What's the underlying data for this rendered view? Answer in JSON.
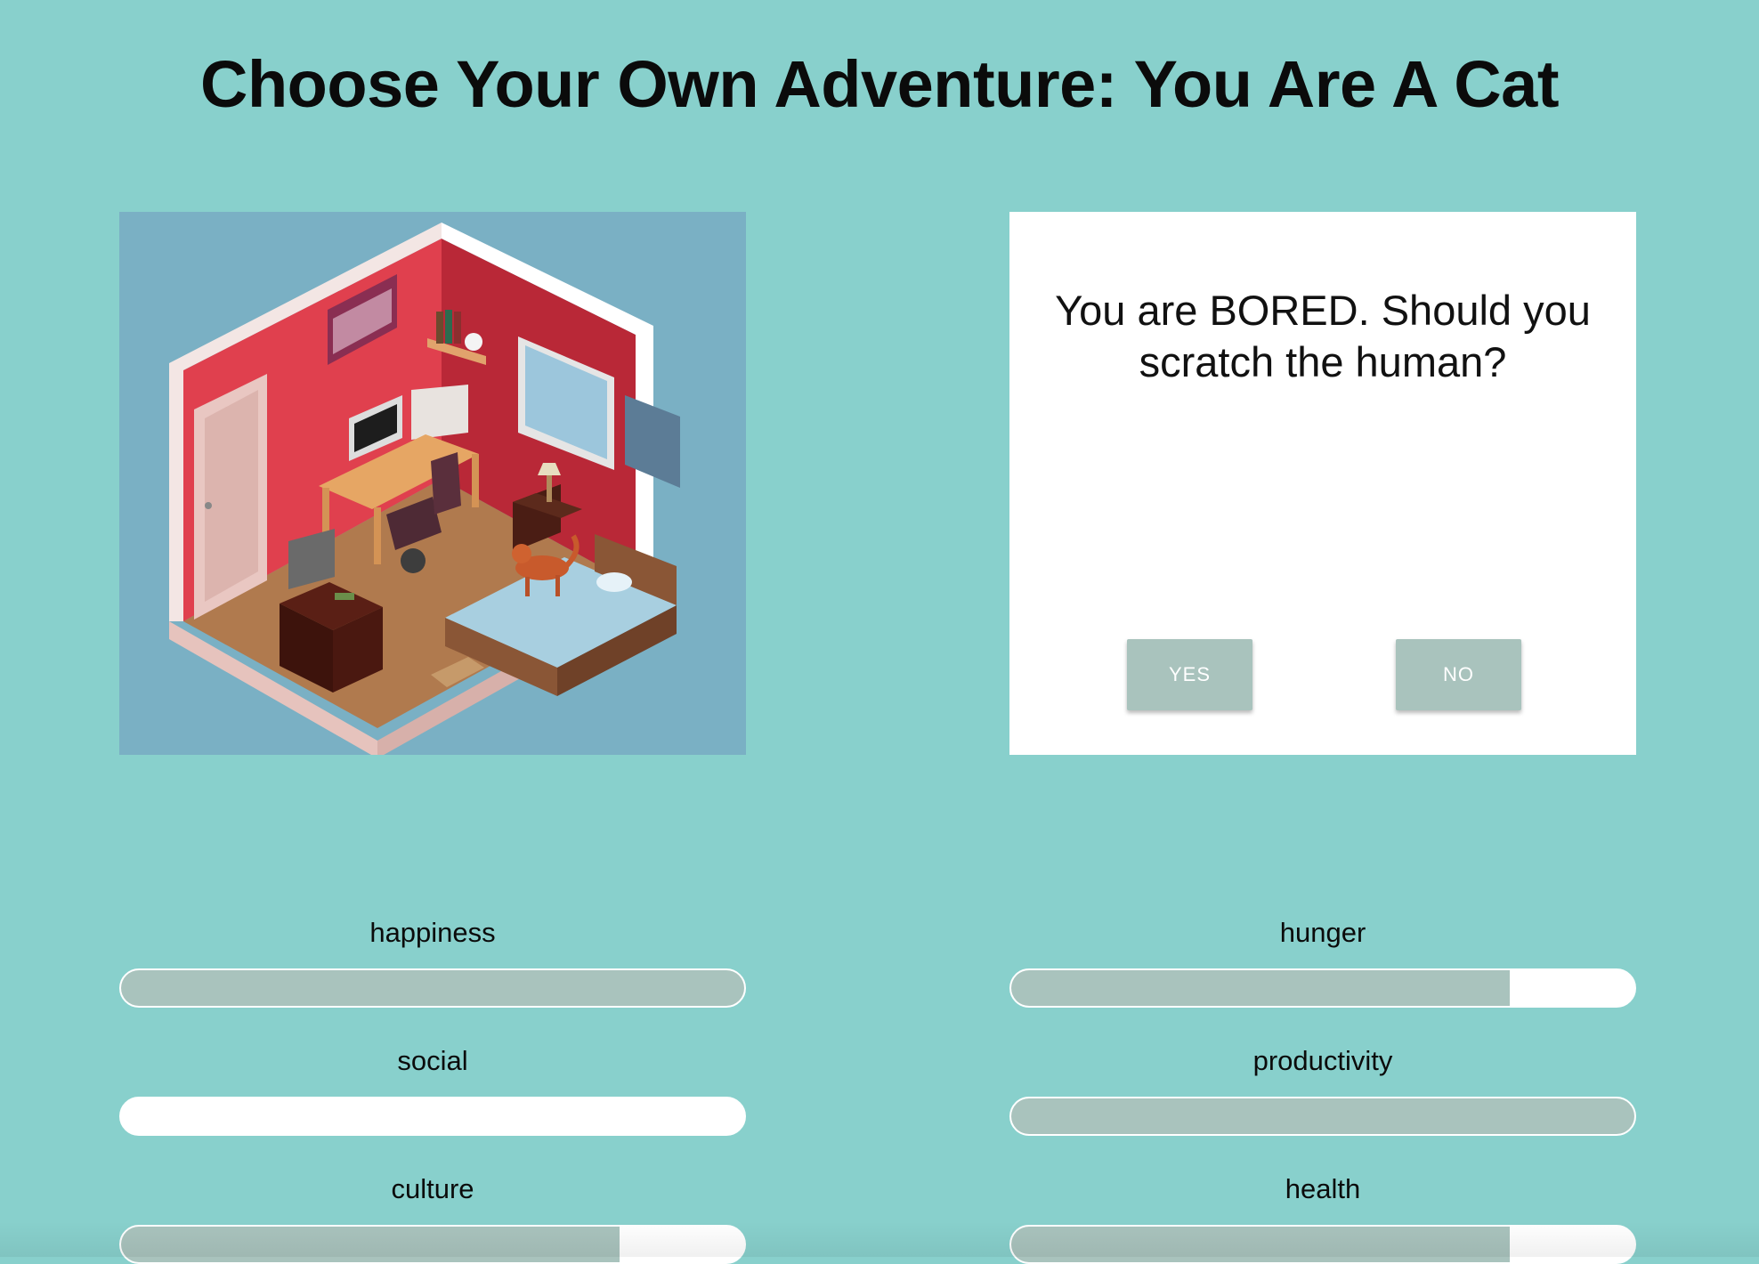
{
  "page": {
    "title": "Choose Your Own Adventure: You Are A Cat"
  },
  "scene": {
    "description_icon": "isometric-bedroom-illustration-with-cat"
  },
  "prompt": {
    "question": "You are BORED. Should you scratch the human?",
    "yes_label": "YES",
    "no_label": "NO"
  },
  "stats": [
    {
      "name": "happiness",
      "level": 1.0
    },
    {
      "name": "hunger",
      "level": 0.8
    },
    {
      "name": "social",
      "level": 0.0
    },
    {
      "name": "productivity",
      "level": 1.0
    },
    {
      "name": "culture",
      "level": 0.8
    },
    {
      "name": "health",
      "level": 0.8
    }
  ],
  "colors": {
    "background": "#88d0cc",
    "bar_fill": "#a9c3bd",
    "bar_empty": "#ffffff",
    "button": "#a9c3bd",
    "card": "#ffffff"
  }
}
